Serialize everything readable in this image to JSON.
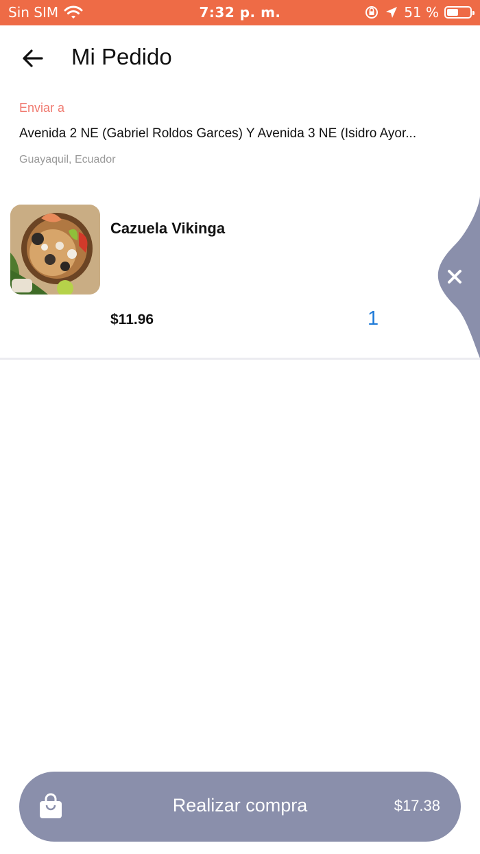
{
  "status_bar": {
    "carrier": "Sin SIM",
    "time": "7:32 p. m.",
    "battery": "51 %",
    "battery_level": 0.51,
    "icons": [
      "wifi-icon",
      "orientation-lock-icon",
      "location-arrow-icon",
      "battery-icon"
    ]
  },
  "header": {
    "title": "Mi Pedido",
    "back_icon": "arrow-left-icon"
  },
  "address": {
    "label": "Enviar a",
    "line": "Avenida 2 NE (Gabriel Roldos Garces) Y Avenida 3 NE (Isidro Ayor...",
    "city": "Guayaquil, Ecuador"
  },
  "cart": {
    "items": [
      {
        "name": "Cazuela Vikinga",
        "price": "$11.96",
        "quantity": "1",
        "image": "seafood-cazuela-photo",
        "delete_icon": "close-icon"
      }
    ]
  },
  "checkout": {
    "label": "Realizar compra",
    "total": "$17.38",
    "icon": "shopping-bag-icon"
  },
  "colors": {
    "status_bar": "#ee6b46",
    "accent_label": "#f07a70",
    "quantity": "#1e7ad8",
    "button": "#8a8fab"
  }
}
